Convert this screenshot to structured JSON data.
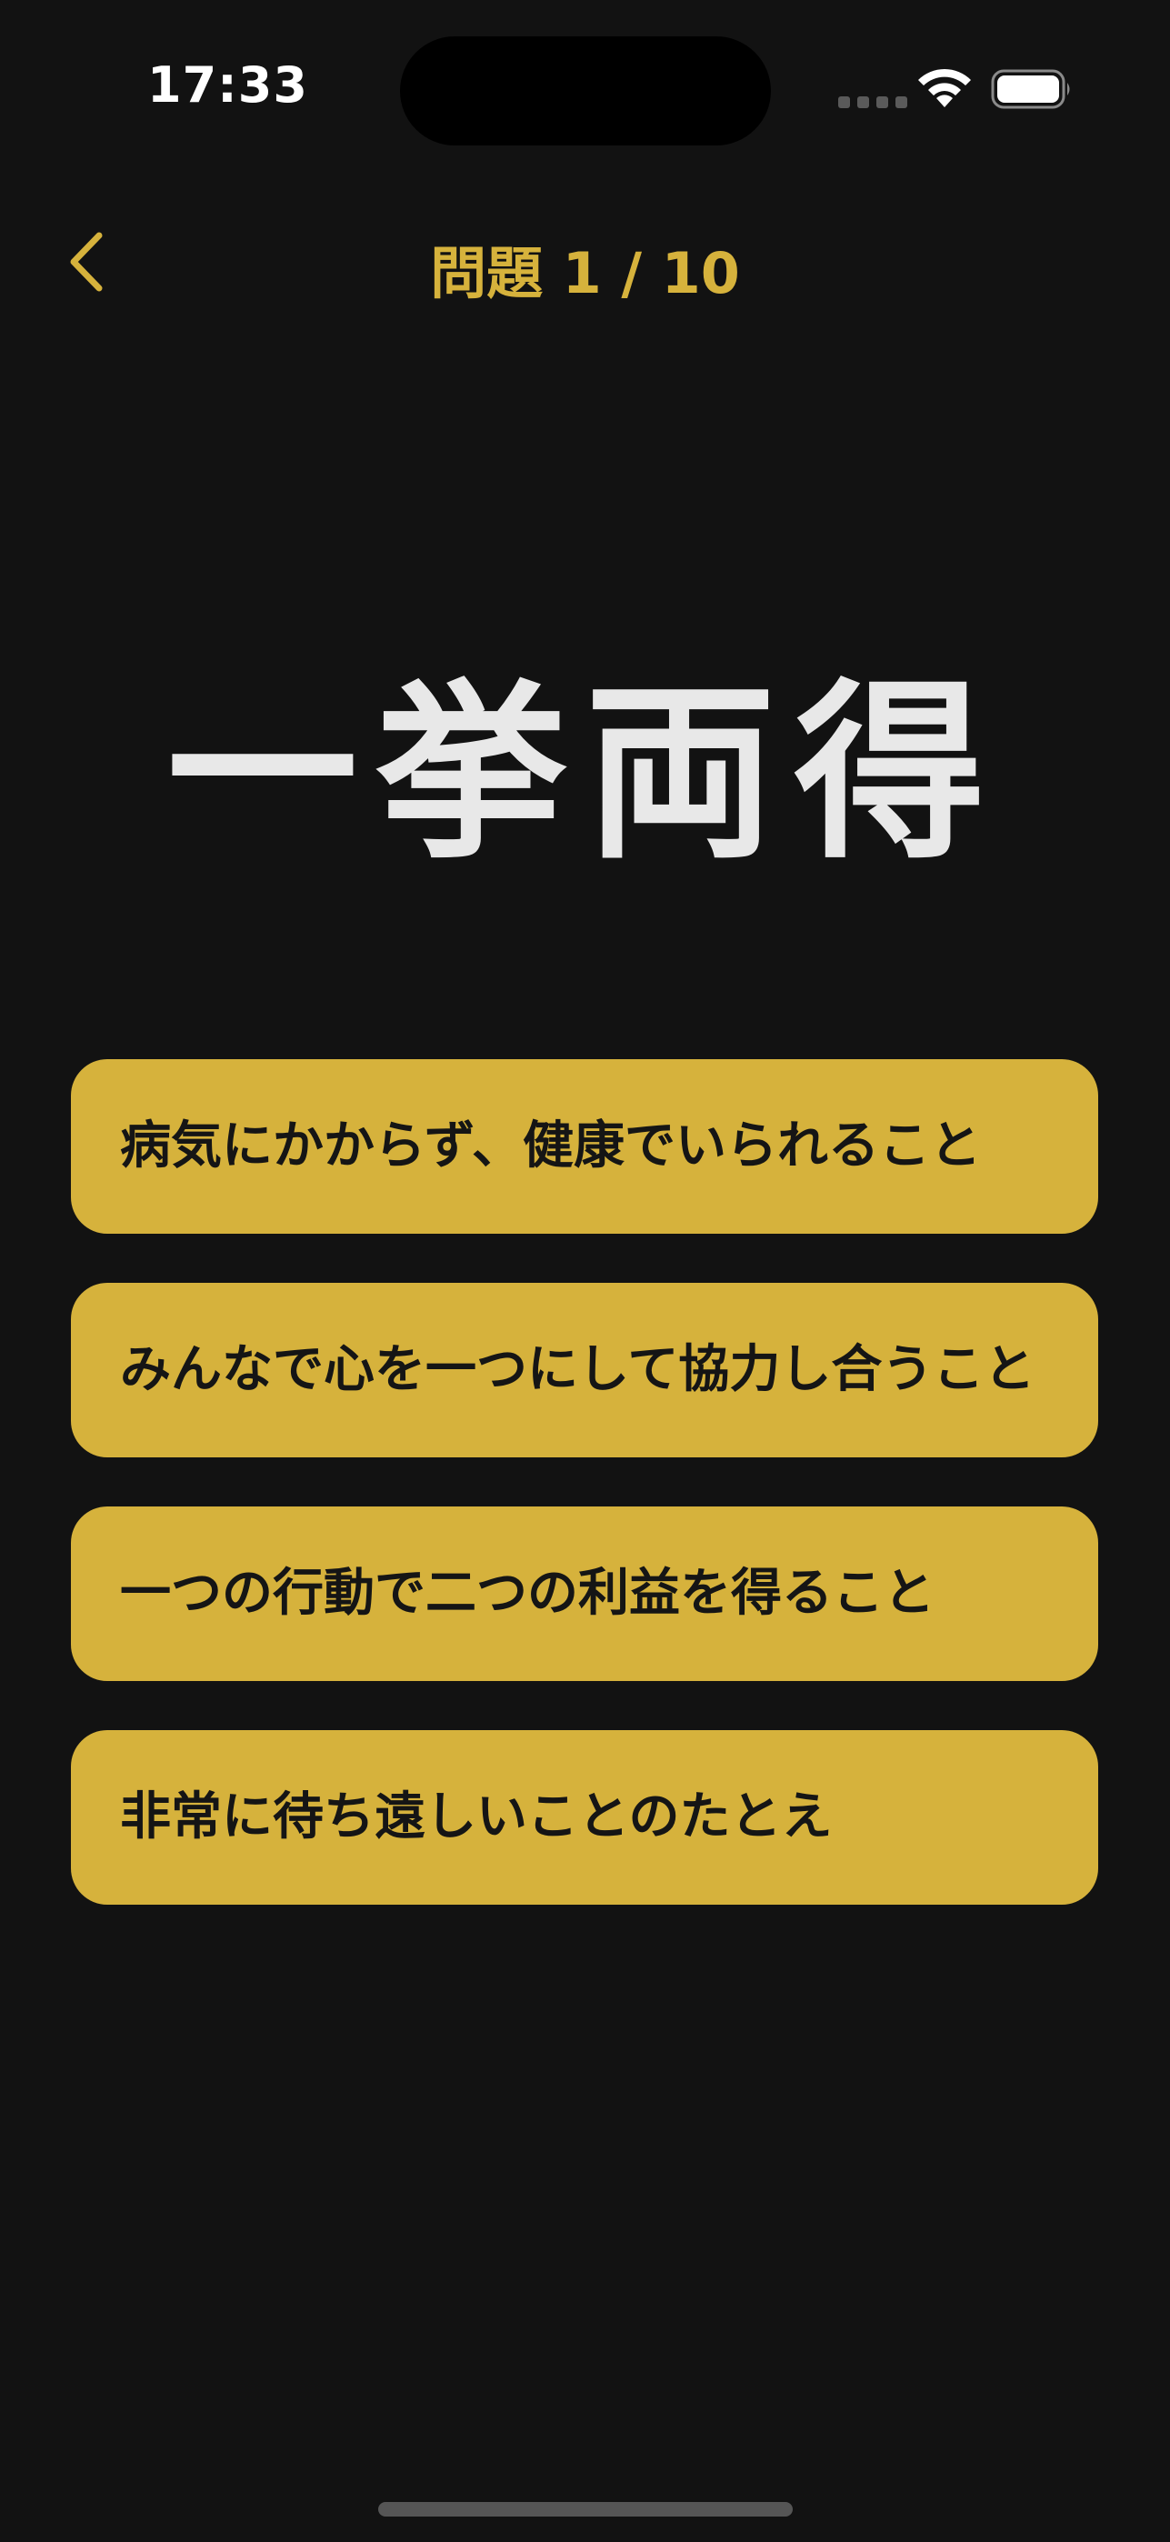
{
  "status_bar": {
    "time": "17:33"
  },
  "header": {
    "title_prefix": "問題",
    "current": "1",
    "separator": "/",
    "total": "10"
  },
  "question": {
    "word": "一挙両得"
  },
  "options": [
    {
      "label": "病気にかからず、健康でいられること"
    },
    {
      "label": "みんなで心を一つにして協力し合うこと"
    },
    {
      "label": "一つの行動で二つの利益を得ること"
    },
    {
      "label": "非常に待ち遠しいことのたとえ"
    }
  ],
  "colors": {
    "background": "#121212",
    "accent": "#d6b23c",
    "word_text": "#e8e8e8",
    "option_text": "#151515"
  },
  "icons": {
    "back": "chevron-left-icon",
    "wifi": "wifi-icon",
    "battery": "battery-icon",
    "signal": "signal-dots-icon"
  }
}
